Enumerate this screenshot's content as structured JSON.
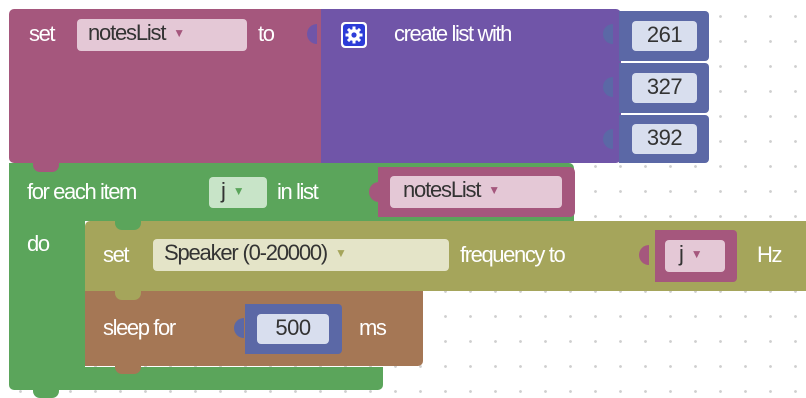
{
  "set_block": {
    "keyword": "set",
    "variable": "notesList",
    "to_label": "to"
  },
  "create_list": {
    "label": "create list with",
    "gear_icon": "gear-icon",
    "items": [
      "261",
      "327",
      "392"
    ]
  },
  "for_each": {
    "label": "for each item",
    "variable": "j",
    "in_list_label": "in list",
    "list_variable": "notesList",
    "do_label": "do"
  },
  "speaker_block": {
    "keyword": "set",
    "device": "Speaker (0-20000)",
    "frequency_label": "frequency to",
    "value_variable": "j",
    "unit": "Hz"
  },
  "sleep_block": {
    "label": "sleep for",
    "value": "500",
    "unit": "ms"
  },
  "colors": {
    "variables": "#a5577d",
    "variables_light": "#e4c8d6",
    "lists": "#7055a8",
    "math": "#5b68a6",
    "math_light": "#d8deee",
    "loops": "#5ba55b",
    "loops_light": "#c8e4c8",
    "speaker": "#a5a55b",
    "speaker_light": "#e4e4c8",
    "timing": "#a57755",
    "timing_light": "#d8deee"
  }
}
